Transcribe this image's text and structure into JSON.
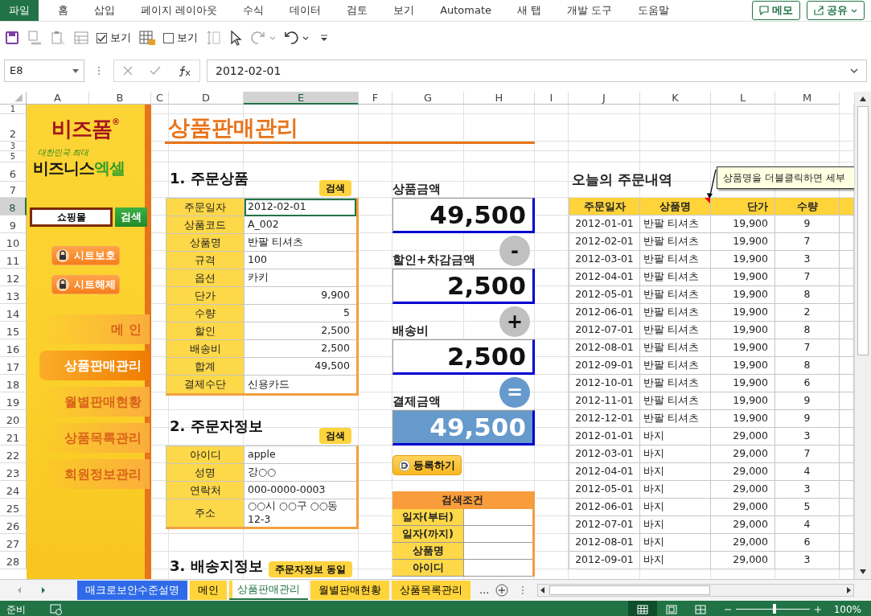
{
  "ribbon": {
    "file_tab": "파일",
    "tabs": [
      "홈",
      "삽입",
      "페이지 레이아웃",
      "수식",
      "데이터",
      "검토",
      "보기",
      "Automate",
      "새 탭",
      "개발 도구",
      "도움말"
    ],
    "memo_button": "메모",
    "share_button": "공유"
  },
  "toolbar": {
    "checkboxes": [
      {
        "label": "보기",
        "checked": true
      },
      {
        "label": "보기",
        "checked": false
      }
    ]
  },
  "formula_bar": {
    "name_box": "E8",
    "value": "2012-02-01"
  },
  "sheet": {
    "columns": [
      {
        "label": "A",
        "selected": false
      },
      {
        "label": "B",
        "selected": false
      },
      {
        "label": "C",
        "selected": false
      },
      {
        "label": "D",
        "selected": false
      },
      {
        "label": "E",
        "selected": true
      },
      {
        "label": "F",
        "selected": false
      },
      {
        "label": "G",
        "selected": false
      },
      {
        "label": "H",
        "selected": false
      },
      {
        "label": "I",
        "selected": false
      },
      {
        "label": "J",
        "selected": false
      },
      {
        "label": "K",
        "selected": false
      },
      {
        "label": "L",
        "selected": false
      },
      {
        "label": "M",
        "selected": false
      }
    ],
    "rows": [
      {
        "label": "1",
        "selected": false
      },
      {
        "label": "2",
        "selected": false
      },
      {
        "label": "3",
        "selected": false
      },
      {
        "label": "5",
        "selected": false
      },
      {
        "label": "6",
        "selected": false
      },
      {
        "label": "7",
        "selected": false
      },
      {
        "label": "8",
        "selected": true
      },
      {
        "label": "9",
        "selected": false
      },
      {
        "label": "10",
        "selected": false
      },
      {
        "label": "11",
        "selected": false
      },
      {
        "label": "12",
        "selected": false
      },
      {
        "label": "13",
        "selected": false
      },
      {
        "label": "14",
        "selected": false
      },
      {
        "label": "15",
        "selected": false
      },
      {
        "label": "16",
        "selected": false
      },
      {
        "label": "17",
        "selected": false
      },
      {
        "label": "18",
        "selected": false
      },
      {
        "label": "19",
        "selected": false
      },
      {
        "label": "20",
        "selected": false
      },
      {
        "label": "21",
        "selected": false
      },
      {
        "label": "22",
        "selected": false
      },
      {
        "label": "23",
        "selected": false
      },
      {
        "label": "24",
        "selected": false
      },
      {
        "label": "25",
        "selected": false
      },
      {
        "label": "26",
        "selected": false
      },
      {
        "label": "27",
        "selected": false
      },
      {
        "label": "28",
        "selected": false
      }
    ]
  },
  "sidebar": {
    "logo": "비즈폼",
    "logo_mark": "®",
    "tagline": "대한민국 최대",
    "brand": "비즈니스",
    "brand_accent": "엑셀",
    "search": {
      "value": "쇼핑몰",
      "button": "검색"
    },
    "buttons": [
      "시트보호",
      "시트해제"
    ],
    "nav": [
      {
        "label": "메 인",
        "selected": false
      },
      {
        "label": "상품판매관리",
        "selected": true
      },
      {
        "label": "월별판매현황",
        "selected": false
      },
      {
        "label": "상품목록관리",
        "selected": false
      },
      {
        "label": "회원정보관리",
        "selected": false
      }
    ]
  },
  "title": "상품판매관리",
  "order_product": {
    "heading": "1. 주문상품",
    "button": "검색",
    "fields": [
      {
        "label": "주문일자",
        "value": "2012-02-01",
        "kind": "text",
        "selected": true
      },
      {
        "label": "상품코드",
        "value": "A_002",
        "kind": "text",
        "selected": false
      },
      {
        "label": "상품명",
        "value": "반팔 티셔츠",
        "kind": "text",
        "selected": false
      },
      {
        "label": "규격",
        "value": "100",
        "kind": "text",
        "selected": false
      },
      {
        "label": "옵션",
        "value": "카키",
        "kind": "text",
        "selected": false
      },
      {
        "label": "단가",
        "value": "9,900",
        "kind": "number",
        "selected": false
      },
      {
        "label": "수량",
        "value": "5",
        "kind": "number",
        "selected": false
      },
      {
        "label": "할인",
        "value": "2,500",
        "kind": "number",
        "selected": false
      },
      {
        "label": "배송비",
        "value": "2,500",
        "kind": "number",
        "selected": false
      },
      {
        "label": "합계",
        "value": "49,500",
        "kind": "number",
        "selected": false
      },
      {
        "label": "결제수단",
        "value": "신용카드",
        "kind": "text",
        "selected": false
      }
    ]
  },
  "orderer": {
    "heading": "2. 주문자정보",
    "button": "검색",
    "fields": [
      {
        "label": "아이디",
        "value": "apple",
        "kind": "text",
        "selected": false
      },
      {
        "label": "성명",
        "value": "강○○",
        "kind": "text",
        "selected": false
      },
      {
        "label": "연락처",
        "value": "000-0000-0003",
        "kind": "text",
        "selected": false
      },
      {
        "label": "주소",
        "value": "○○시 ○○구 ○○동 12-3",
        "kind": "text",
        "selected": false
      }
    ]
  },
  "shipping": {
    "heading": "3. 배송지정보",
    "button": "주문자정보 동일"
  },
  "amounts": [
    {
      "label": "상품금액",
      "value": "49,500",
      "kind": "plain"
    },
    {
      "label": "할인+차감금액",
      "value": "2,500",
      "kind": "plain",
      "operator": "-"
    },
    {
      "label": "배송비",
      "value": "2,500",
      "kind": "plain",
      "operator": "+"
    },
    {
      "label": "결제금액",
      "value": "49,500",
      "kind": "total",
      "operator": "="
    }
  ],
  "register_button": "등록하기",
  "search_conditions": {
    "title": "검색조건",
    "fields": [
      "일자(부터)",
      "일자(까지)",
      "상품명",
      "아이디"
    ]
  },
  "orders": {
    "title": "오늘의 주문내역",
    "comment": "상품명을 더블클릭하면 세부",
    "columns": [
      "주문일자",
      "상품명",
      "단가",
      "수량"
    ],
    "rows": [
      [
        "2012-01-01",
        "반팔 티셔츠",
        "19,900",
        "9"
      ],
      [
        "2012-02-01",
        "반팔 티셔츠",
        "19,900",
        "7"
      ],
      [
        "2012-03-01",
        "반팔 티셔츠",
        "19,900",
        "3"
      ],
      [
        "2012-04-01",
        "반팔 티셔츠",
        "19,900",
        "7"
      ],
      [
        "2012-05-01",
        "반팔 티셔츠",
        "19,900",
        "8"
      ],
      [
        "2012-06-01",
        "반팔 티셔츠",
        "19,900",
        "2"
      ],
      [
        "2012-07-01",
        "반팔 티셔츠",
        "19,900",
        "8"
      ],
      [
        "2012-08-01",
        "반팔 티셔츠",
        "19,900",
        "7"
      ],
      [
        "2012-09-01",
        "반팔 티셔츠",
        "19,900",
        "8"
      ],
      [
        "2012-10-01",
        "반팔 티셔츠",
        "19,900",
        "6"
      ],
      [
        "2012-11-01",
        "반팔 티셔츠",
        "19,900",
        "9"
      ],
      [
        "2012-12-01",
        "반팔 티셔츠",
        "19,900",
        "9"
      ],
      [
        "2012-01-01",
        "바지",
        "29,000",
        "3"
      ],
      [
        "2012-03-01",
        "바지",
        "29,000",
        "7"
      ],
      [
        "2012-04-01",
        "바지",
        "29,000",
        "4"
      ],
      [
        "2012-05-01",
        "바지",
        "29,000",
        "3"
      ],
      [
        "2012-06-01",
        "바지",
        "29,000",
        "5"
      ],
      [
        "2012-07-01",
        "바지",
        "29,000",
        "4"
      ],
      [
        "2012-08-01",
        "바지",
        "29,000",
        "6"
      ],
      [
        "2012-09-01",
        "바지",
        "29,000",
        "3"
      ]
    ]
  },
  "sheet_tabs": [
    {
      "label": "매크로보안수준설명",
      "color": "#2f6be8",
      "selected": false
    },
    {
      "label": "메인",
      "color": "#ffd43b",
      "selected": false
    },
    {
      "label": "상품판매관리",
      "color": "#ffd43b",
      "selected": true
    },
    {
      "label": "월별판매현황",
      "color": "#ffd43b",
      "selected": false
    },
    {
      "label": "상품목록관리",
      "color": "#ffd43b",
      "selected": false
    }
  ],
  "more_tabs": "...",
  "status_bar": {
    "status": "준비",
    "zoom": "100%",
    "level": 0.5
  }
}
